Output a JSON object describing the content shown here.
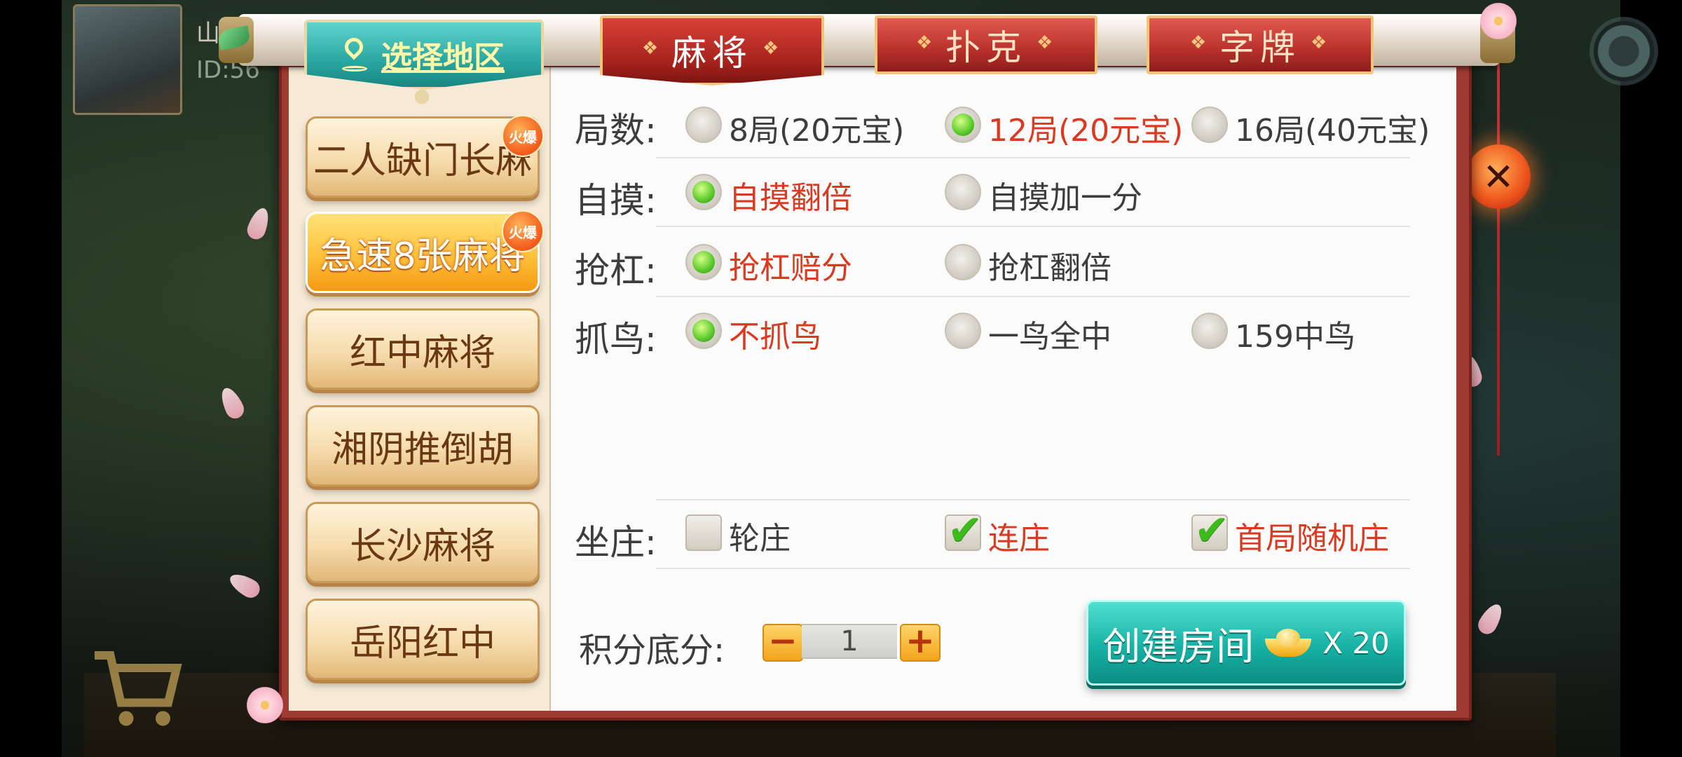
{
  "player": {
    "name": "山水",
    "id": "ID:56"
  },
  "region": {
    "label": "选择地区"
  },
  "tabs": [
    {
      "label": "麻将"
    },
    {
      "label": "扑克"
    },
    {
      "label": "字牌"
    }
  ],
  "modes": [
    {
      "label": "二人缺门长麻",
      "badge": "火爆"
    },
    {
      "label": "急速8张麻将",
      "badge": "火爆"
    },
    {
      "label": "红中麻将"
    },
    {
      "label": "湘阴推倒胡"
    },
    {
      "label": "长沙麻将"
    },
    {
      "label": "岳阳红中"
    }
  ],
  "rules": {
    "rounds": {
      "label": "局数:",
      "options": [
        "8局(20元宝)",
        "12局(20元宝)",
        "16局(40元宝)"
      ],
      "selected": 1
    },
    "self_draw": {
      "label": "自摸:",
      "options": [
        "自摸翻倍",
        "自摸加一分"
      ],
      "selected": 0
    },
    "rob_kong": {
      "label": "抢杠:",
      "options": [
        "抢杠赔分",
        "抢杠翻倍"
      ],
      "selected": 0
    },
    "bird": {
      "label": "抓鸟:",
      "options": [
        "不抓鸟",
        "一鸟全中",
        "159中鸟"
      ],
      "selected": 0
    },
    "dealer": {
      "label": "坐庄:",
      "options": [
        "轮庄",
        "连庄",
        "首局随机庄"
      ],
      "checked": [
        false,
        true,
        true
      ]
    }
  },
  "score": {
    "label": "积分底分:",
    "value": "1",
    "minus": "−",
    "plus": "+"
  },
  "create": {
    "label": "创建房间",
    "cost": "X 20"
  },
  "close": {
    "glyph": "✕"
  },
  "colors": {
    "accent_red": "#d93a20",
    "radio_green": "#58c92a",
    "teal": "#17b2a5",
    "frame_red": "#9e3b32"
  }
}
